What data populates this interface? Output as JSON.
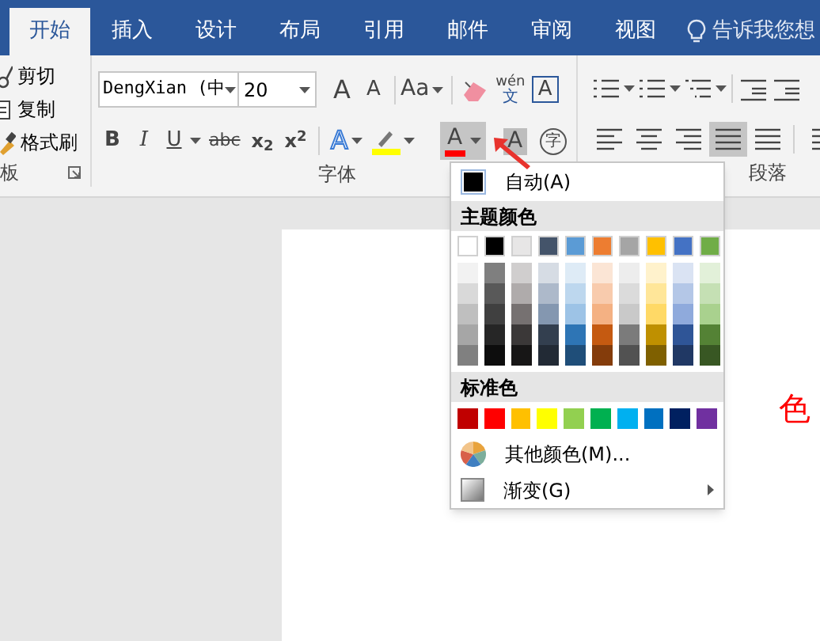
{
  "tabs": [
    {
      "label": "开始",
      "selected": true
    },
    {
      "label": "插入",
      "selected": false
    },
    {
      "label": "设计",
      "selected": false
    },
    {
      "label": "布局",
      "selected": false
    },
    {
      "label": "引用",
      "selected": false
    },
    {
      "label": "邮件",
      "selected": false
    },
    {
      "label": "审阅",
      "selected": false
    },
    {
      "label": "视图",
      "selected": false
    }
  ],
  "tell_me": "告诉我您想",
  "clipboard": {
    "items": [
      {
        "kind": "cut",
        "label": "剪切"
      },
      {
        "kind": "copy",
        "label": "复制"
      },
      {
        "kind": "painter",
        "label": "格式刷"
      }
    ],
    "group_label": "板"
  },
  "font": {
    "name": "DengXian (中",
    "size": "20",
    "grow": "A",
    "shrink": "A",
    "case": "Aa",
    "phonetic_top": "wén",
    "phonetic_bottom": "文",
    "border": "A",
    "bold": "B",
    "italic": "I",
    "underline": "U",
    "strike": "abc",
    "subscript": "x$_{2}$",
    "superscript": "x$^{2}$",
    "effects": "A",
    "highlight": {
      "color": "#ffff00"
    },
    "font_color": {
      "label": "A",
      "color": "#ff0000",
      "expanded": true
    },
    "shading": "A",
    "enclose": "字",
    "group_label": "字体"
  },
  "paragraph": {
    "group_label": "段落",
    "alignments": [
      {
        "kind": "left",
        "selected": false
      },
      {
        "kind": "center",
        "selected": false
      },
      {
        "kind": "right",
        "selected": false
      },
      {
        "kind": "justify",
        "selected": true
      },
      {
        "kind": "distributed",
        "selected": false
      }
    ]
  },
  "color_menu": {
    "auto": {
      "label": "自动(A)",
      "color": "#000000"
    },
    "theme_header": "主题颜色",
    "theme_colors": [
      {
        "color": "#ffffff",
        "shades": [
          {
            "color": "#f2f2f2"
          },
          {
            "color": "#d9d9d9"
          },
          {
            "color": "#bfbfbf"
          },
          {
            "color": "#a6a6a6"
          },
          {
            "color": "#808080"
          }
        ]
      },
      {
        "color": "#000000",
        "shades": [
          {
            "color": "#7f7f7f"
          },
          {
            "color": "#595959"
          },
          {
            "color": "#404040"
          },
          {
            "color": "#262626"
          },
          {
            "color": "#0d0d0d"
          }
        ]
      },
      {
        "color": "#e7e6e6",
        "shades": [
          {
            "color": "#d0cece"
          },
          {
            "color": "#afabab"
          },
          {
            "color": "#767171"
          },
          {
            "color": "#3b3838"
          },
          {
            "color": "#171616"
          }
        ]
      },
      {
        "color": "#44546a",
        "shades": [
          {
            "color": "#d6dce4"
          },
          {
            "color": "#adb9ca"
          },
          {
            "color": "#8497b0"
          },
          {
            "color": "#333f4f"
          },
          {
            "color": "#222a35"
          }
        ]
      },
      {
        "color": "#5b9bd5",
        "shades": [
          {
            "color": "#deebf6"
          },
          {
            "color": "#bdd7ee"
          },
          {
            "color": "#9dc3e6"
          },
          {
            "color": "#2e75b5"
          },
          {
            "color": "#1f4e79"
          }
        ]
      },
      {
        "color": "#ed7d31",
        "shades": [
          {
            "color": "#fbe5d5"
          },
          {
            "color": "#f8cbad"
          },
          {
            "color": "#f4b183"
          },
          {
            "color": "#c55a11"
          },
          {
            "color": "#843c0b"
          }
        ]
      },
      {
        "color": "#a5a5a5",
        "shades": [
          {
            "color": "#ededed"
          },
          {
            "color": "#dbdbdb"
          },
          {
            "color": "#c9c9c9"
          },
          {
            "color": "#7b7b7b"
          },
          {
            "color": "#525252"
          }
        ]
      },
      {
        "color": "#ffc000",
        "shades": [
          {
            "color": "#fff2cc"
          },
          {
            "color": "#ffe699"
          },
          {
            "color": "#ffd966"
          },
          {
            "color": "#bf9000"
          },
          {
            "color": "#7f6000"
          }
        ]
      },
      {
        "color": "#4472c4",
        "shades": [
          {
            "color": "#dae3f3"
          },
          {
            "color": "#b4c7e7"
          },
          {
            "color": "#8faadc"
          },
          {
            "color": "#2f5597"
          },
          {
            "color": "#203864"
          }
        ]
      },
      {
        "color": "#70ad47",
        "shades": [
          {
            "color": "#e2f0d9"
          },
          {
            "color": "#c5e0b4"
          },
          {
            "color": "#a9d18e"
          },
          {
            "color": "#548235"
          },
          {
            "color": "#385723"
          }
        ]
      }
    ],
    "standard_header": "标准色",
    "standard_colors": [
      {
        "color": "#c00000"
      },
      {
        "color": "#ff0000"
      },
      {
        "color": "#ffc000"
      },
      {
        "color": "#ffff00"
      },
      {
        "color": "#92d050"
      },
      {
        "color": "#00b050"
      },
      {
        "color": "#00b0f0"
      },
      {
        "color": "#0070c0"
      },
      {
        "color": "#002060"
      },
      {
        "color": "#7030a0"
      }
    ],
    "more": "其他颜色(M)...",
    "gradient": "渐变(G)"
  },
  "document": {
    "text": "色"
  }
}
